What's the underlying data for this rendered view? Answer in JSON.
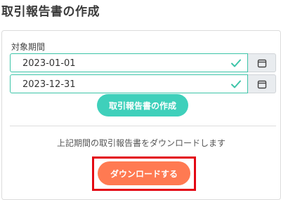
{
  "page": {
    "title": "取引報告書の作成"
  },
  "form": {
    "period_label": "対象期間",
    "start_date": "2023-01-01",
    "end_date": "2023-12-31",
    "create_button_label": "取引報告書の作成"
  },
  "download": {
    "description": "上記期間の取引報告書をダウンロードします",
    "button_label": "ダウンロードする"
  },
  "colors": {
    "valid_border": "#3cc4a8",
    "check_icon": "#3cc4a8",
    "create_button": "#3fd0bb",
    "download_button": "#ff7a52",
    "highlight": "#e30613"
  },
  "icons": {
    "valid": "check-icon",
    "calendar": "calendar-icon"
  }
}
